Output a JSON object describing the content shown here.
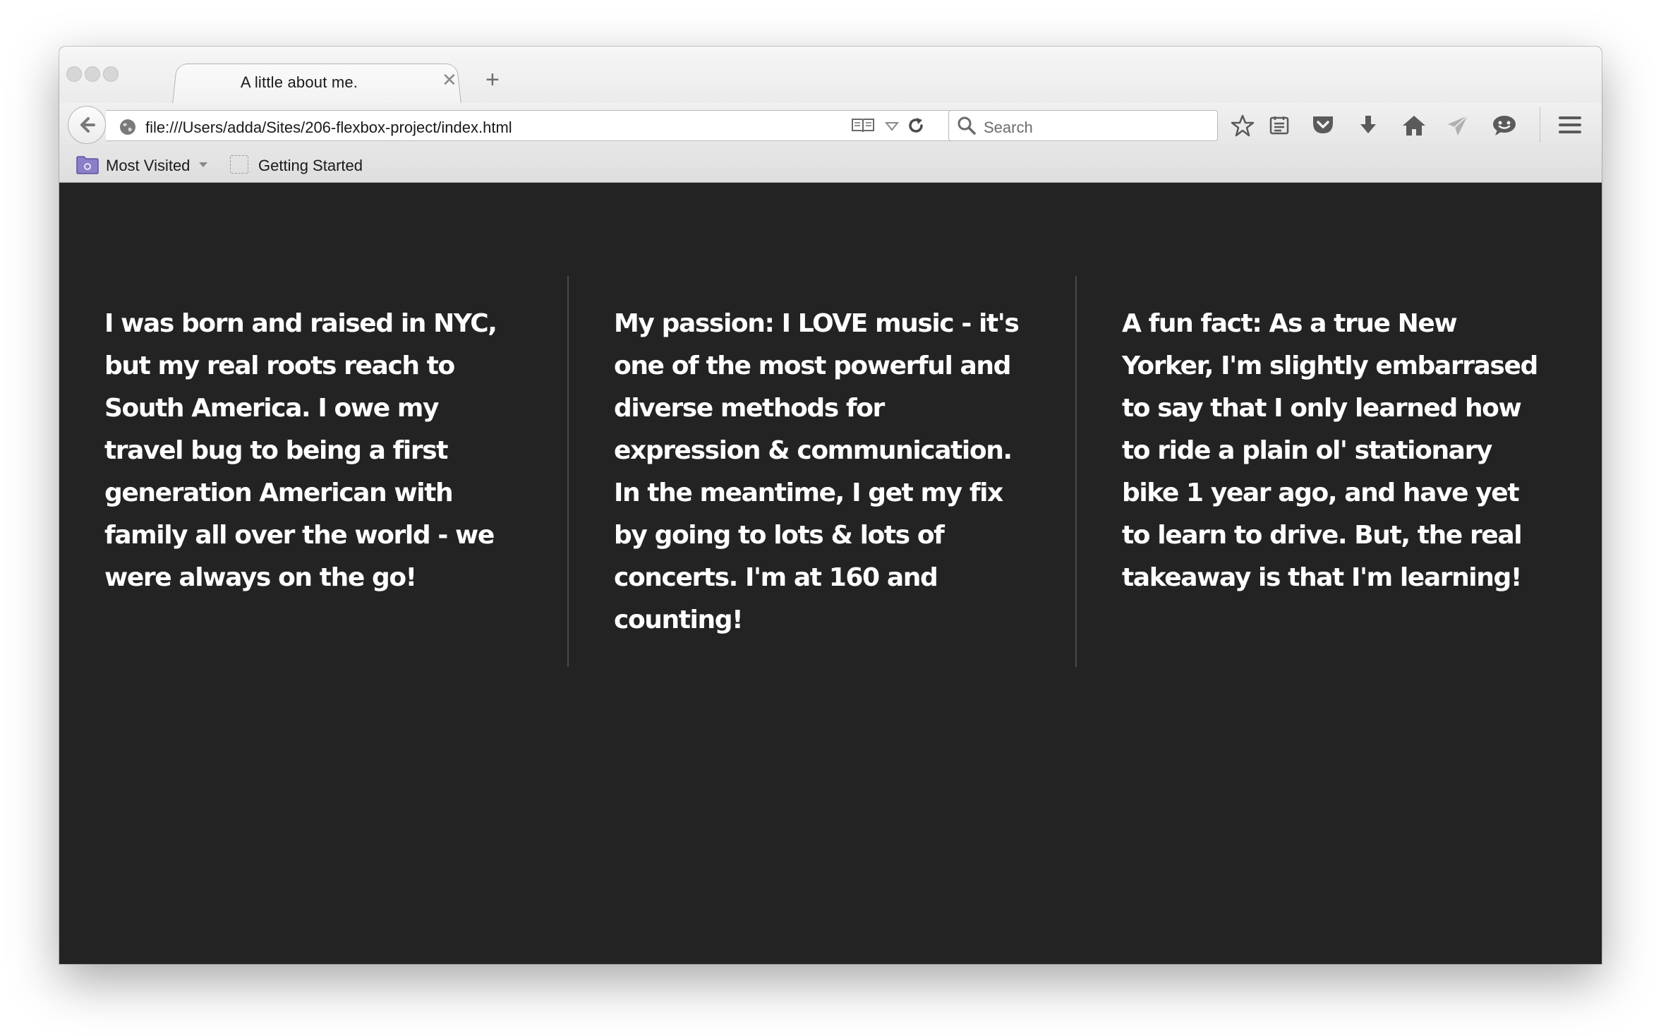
{
  "browser": {
    "tab": {
      "title": "A little about me.",
      "close_glyph": "✕",
      "new_tab_glyph": "+"
    },
    "address_bar": {
      "url": "file:///Users/adda/Sites/206-flexbox-project/index.html"
    },
    "search_bar": {
      "placeholder": "Search"
    },
    "toolbar_icons": [
      "bookmark-star-icon",
      "reading-list-icon",
      "pocket-icon",
      "downloads-icon",
      "home-icon",
      "share-icon",
      "chat-icon",
      "menu-icon"
    ],
    "bookmarks": [
      {
        "label": "Most Visited",
        "icon": "folder-icon"
      },
      {
        "label": "Getting Started",
        "icon": "page-icon"
      }
    ]
  },
  "page": {
    "background": "#232323",
    "text_color": "#ffffff",
    "columns": [
      {
        "text": "I was born and raised in NYC, but my real roots reach to South America. I owe my travel bug to being a first generation American with family all over the world - we were always on the go!"
      },
      {
        "text": "My passion: I LOVE music - it's one of the most powerful and diverse methods for expression & communication. In the meantime, I get my fix by going to lots & lots of concerts. I'm at 160 and counting!"
      },
      {
        "text": "A fun fact: As a true New Yorker, I'm slightly embarrased to say that I only learned how to ride a plain ol' stationary bike 1 year ago, and have yet to learn to drive. But, the real takeaway is that I'm learning!"
      }
    ]
  }
}
